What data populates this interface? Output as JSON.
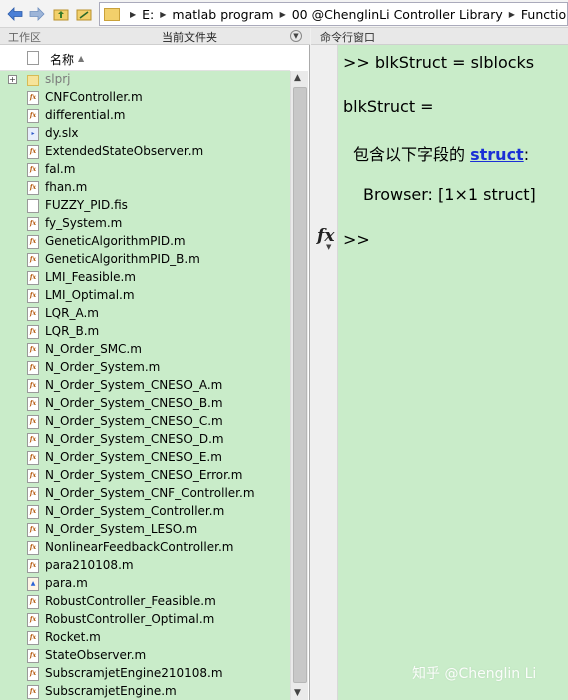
{
  "address_bar": {
    "drive": "E:",
    "segments": [
      "matlab program",
      "00 @ChenglinLi Controller Library",
      "Function"
    ]
  },
  "left_panel": {
    "workspace_tab": "工作区",
    "current_folder_tab": "当前文件夹",
    "name_column": "名称"
  },
  "files": [
    {
      "name": "slprj",
      "type": "folder"
    },
    {
      "name": "CNFController.m",
      "type": "m"
    },
    {
      "name": "differential.m",
      "type": "m"
    },
    {
      "name": "dy.slx",
      "type": "slx"
    },
    {
      "name": "ExtendedStateObserver.m",
      "type": "m"
    },
    {
      "name": "fal.m",
      "type": "m"
    },
    {
      "name": "fhan.m",
      "type": "m"
    },
    {
      "name": "FUZZY_PID.fis",
      "type": "fis"
    },
    {
      "name": "fy_System.m",
      "type": "m"
    },
    {
      "name": "GeneticAlgorithmPID.m",
      "type": "m"
    },
    {
      "name": "GeneticAlgorithmPID_B.m",
      "type": "m"
    },
    {
      "name": "LMI_Feasible.m",
      "type": "m"
    },
    {
      "name": "LMI_Optimal.m",
      "type": "m"
    },
    {
      "name": "LQR_A.m",
      "type": "m"
    },
    {
      "name": "LQR_B.m",
      "type": "m"
    },
    {
      "name": "N_Order_SMC.m",
      "type": "m"
    },
    {
      "name": "N_Order_System.m",
      "type": "m"
    },
    {
      "name": "N_Order_System_CNESO_A.m",
      "type": "m"
    },
    {
      "name": "N_Order_System_CNESO_B.m",
      "type": "m"
    },
    {
      "name": "N_Order_System_CNESO_C.m",
      "type": "m"
    },
    {
      "name": "N_Order_System_CNESO_D.m",
      "type": "m"
    },
    {
      "name": "N_Order_System_CNESO_E.m",
      "type": "m"
    },
    {
      "name": "N_Order_System_CNESO_Error.m",
      "type": "m"
    },
    {
      "name": "N_Order_System_CNF_Controller.m",
      "type": "m"
    },
    {
      "name": "N_Order_System_Controller.m",
      "type": "m"
    },
    {
      "name": "N_Order_System_LESO.m",
      "type": "m"
    },
    {
      "name": "NonlinearFeedbackController.m",
      "type": "m"
    },
    {
      "name": "para210108.m",
      "type": "m"
    },
    {
      "name": "para.m",
      "type": "mat"
    },
    {
      "name": "RobustController_Feasible.m",
      "type": "m"
    },
    {
      "name": "RobustController_Optimal.m",
      "type": "m"
    },
    {
      "name": "Rocket.m",
      "type": "m"
    },
    {
      "name": "StateObserver.m",
      "type": "m"
    },
    {
      "name": "SubscramjetEngine210108.m",
      "type": "m"
    },
    {
      "name": "SubscramjetEngine.m",
      "type": "m"
    }
  ],
  "command_window": {
    "title": "命令行窗口",
    "command": ">> blkStruct = slblocks",
    "result_var": "blkStruct =",
    "struct_prefix": "包含以下字段的",
    "struct_link": "struct",
    "struct_suffix": ":",
    "field_line": "Browser: [1×1 struct]",
    "prompt": ">>",
    "fx_label": "fx"
  },
  "watermark": "知乎 @Chenglin Li",
  "colors": {
    "panel_green": "#c9ecc9",
    "link_blue": "#1a2fd6"
  }
}
